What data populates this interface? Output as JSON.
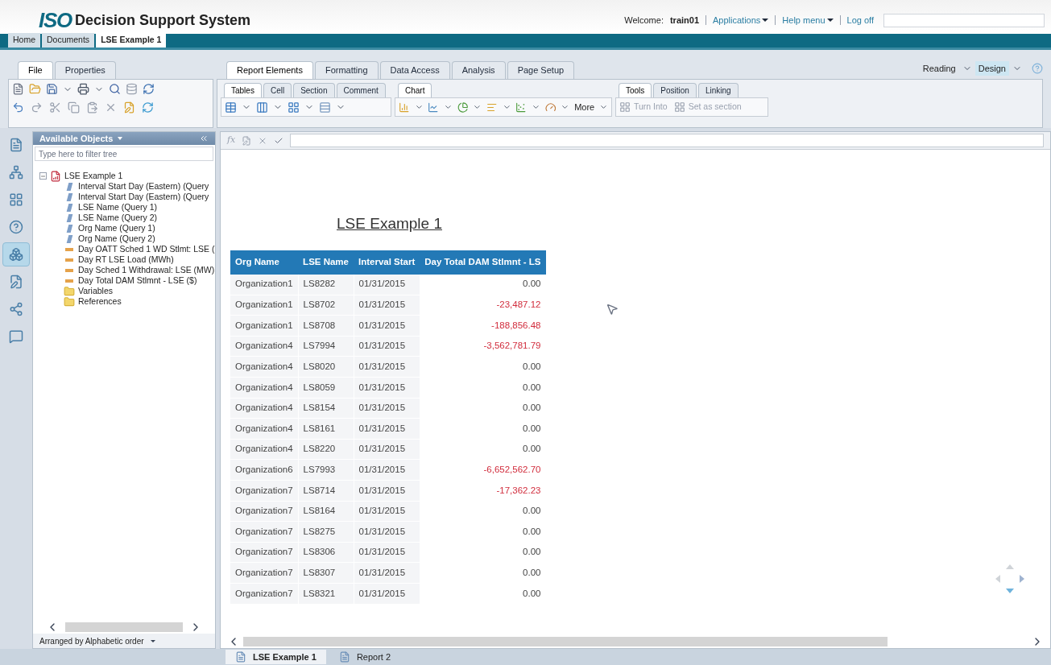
{
  "header": {
    "logo_text": "ISO",
    "title": "Decision Support System",
    "welcome_label": "Welcome:",
    "user": "train01",
    "links": [
      {
        "label": "Applications",
        "dropdown": true
      },
      {
        "label": "Help menu",
        "dropdown": true
      },
      {
        "label": "Log off",
        "dropdown": false
      }
    ]
  },
  "doc_tabs": [
    {
      "label": "Home",
      "selected": false
    },
    {
      "label": "Documents",
      "selected": false
    },
    {
      "label": "LSE Example 1",
      "selected": true
    }
  ],
  "left_ribbon_tabs": [
    {
      "label": "File",
      "selected": true
    },
    {
      "label": "Properties",
      "selected": false
    }
  ],
  "main_ribbon_tabs": [
    {
      "label": "Report Elements",
      "selected": true
    },
    {
      "label": "Formatting",
      "selected": false
    },
    {
      "label": "Data Access",
      "selected": false
    },
    {
      "label": "Analysis",
      "selected": false
    },
    {
      "label": "Page Setup",
      "selected": false
    }
  ],
  "modes": [
    {
      "label": "Reading",
      "selected": false
    },
    {
      "label": "Design",
      "selected": true
    }
  ],
  "sub_tabs_tables": [
    {
      "label": "Tables",
      "selected": true
    },
    {
      "label": "Cell",
      "selected": false
    },
    {
      "label": "Section",
      "selected": false
    },
    {
      "label": "Comment",
      "selected": false
    }
  ],
  "sub_tabs_chart": [
    {
      "label": "Chart",
      "selected": true
    }
  ],
  "sub_tabs_tools": [
    {
      "label": "Tools",
      "selected": true
    },
    {
      "label": "Position",
      "selected": false
    },
    {
      "label": "Linking",
      "selected": false
    }
  ],
  "more_label": "More",
  "formula_symbol": "fx",
  "tools_buttons": [
    {
      "label": "Turn Into",
      "disabled": true
    },
    {
      "label": "Set as section",
      "disabled": true
    }
  ],
  "side_icons": [
    {
      "selected": false
    },
    {
      "selected": false
    },
    {
      "selected": false
    },
    {
      "selected": false
    },
    {
      "selected": true
    },
    {
      "selected": false
    },
    {
      "selected": false
    },
    {
      "selected": false
    }
  ],
  "objects_panel": {
    "title": "Available Objects",
    "filter_placeholder": "Type here to filter tree",
    "footer": "Arranged by Alphabetic order",
    "tree": [
      {
        "label": "LSE Example 1",
        "kind": "document",
        "expanded": true,
        "children": [
          {
            "label": "Interval Start Day (Eastern) (Query",
            "kind": "dimension"
          },
          {
            "label": "Interval Start Day (Eastern) (Query",
            "kind": "dimension"
          },
          {
            "label": "LSE Name (Query 1)",
            "kind": "dimension"
          },
          {
            "label": "LSE Name (Query 2)",
            "kind": "dimension"
          },
          {
            "label": "Org Name (Query 1)",
            "kind": "dimension"
          },
          {
            "label": "Org Name (Query 2)",
            "kind": "dimension"
          },
          {
            "label": "Day OATT Sched 1 WD Stlmt: LSE (",
            "kind": "measure"
          },
          {
            "label": "Day RT LSE Load (MWh)",
            "kind": "measure"
          },
          {
            "label": "Day Sched 1 Withdrawal: LSE (MW)",
            "kind": "measure"
          },
          {
            "label": "Day Total DAM Stlmnt - LSE ($)",
            "kind": "measure"
          },
          {
            "label": "Variables",
            "kind": "folder"
          },
          {
            "label": "References",
            "kind": "folder"
          }
        ]
      }
    ]
  },
  "report": {
    "title": "LSE Example 1",
    "columns": [
      "Org Name",
      "LSE Name",
      "Interval Start",
      "Day Total DAM Stlmnt - LS"
    ],
    "rows": [
      {
        "org": "Organization1",
        "lse": "LS8282",
        "date": "01/31/2015",
        "amount": "0.00",
        "negative": false
      },
      {
        "org": "Organization1",
        "lse": "LS8702",
        "date": "01/31/2015",
        "amount": "-23,487.12",
        "negative": true
      },
      {
        "org": "Organization1",
        "lse": "LS8708",
        "date": "01/31/2015",
        "amount": "-188,856.48",
        "negative": true
      },
      {
        "org": "Organization4",
        "lse": "LS7994",
        "date": "01/31/2015",
        "amount": "-3,562,781.79",
        "negative": true
      },
      {
        "org": "Organization4",
        "lse": "LS8020",
        "date": "01/31/2015",
        "amount": "0.00",
        "negative": false
      },
      {
        "org": "Organization4",
        "lse": "LS8059",
        "date": "01/31/2015",
        "amount": "0.00",
        "negative": false
      },
      {
        "org": "Organization4",
        "lse": "LS8154",
        "date": "01/31/2015",
        "amount": "0.00",
        "negative": false
      },
      {
        "org": "Organization4",
        "lse": "LS8161",
        "date": "01/31/2015",
        "amount": "0.00",
        "negative": false
      },
      {
        "org": "Organization4",
        "lse": "LS8220",
        "date": "01/31/2015",
        "amount": "0.00",
        "negative": false
      },
      {
        "org": "Organization6",
        "lse": "LS7993",
        "date": "01/31/2015",
        "amount": "-6,652,562.70",
        "negative": true
      },
      {
        "org": "Organization7",
        "lse": "LS8714",
        "date": "01/31/2015",
        "amount": "-17,362.23",
        "negative": true
      },
      {
        "org": "Organization7",
        "lse": "LS8164",
        "date": "01/31/2015",
        "amount": "0.00",
        "negative": false
      },
      {
        "org": "Organization7",
        "lse": "LS8275",
        "date": "01/31/2015",
        "amount": "0.00",
        "negative": false
      },
      {
        "org": "Organization7",
        "lse": "LS8306",
        "date": "01/31/2015",
        "amount": "0.00",
        "negative": false
      },
      {
        "org": "Organization7",
        "lse": "LS8307",
        "date": "01/31/2015",
        "amount": "0.00",
        "negative": false
      },
      {
        "org": "Organization7",
        "lse": "LS8321",
        "date": "01/31/2015",
        "amount": "0.00",
        "negative": false
      }
    ]
  },
  "report_tabs": [
    {
      "label": "LSE Example 1",
      "selected": true
    },
    {
      "label": "Report 2",
      "selected": false
    }
  ]
}
